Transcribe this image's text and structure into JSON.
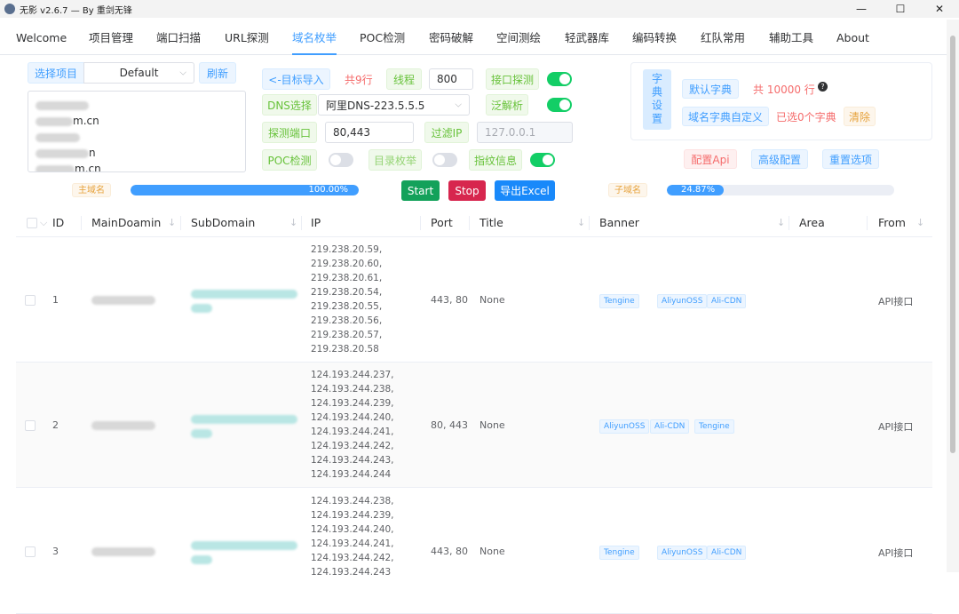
{
  "window": {
    "title": "无影 v2.6.7 — By 重剑无锋",
    "minimize": "—",
    "maximize": "☐",
    "close": "✕"
  },
  "tabs": [
    "Welcome",
    "项目管理",
    "端口扫描",
    "URL探测",
    "域名枚举",
    "POC检测",
    "密码破解",
    "空间测绘",
    "轻武器库",
    "编码转换",
    "红队常用",
    "辅助工具",
    "About"
  ],
  "active_tab": "域名枚举",
  "project": {
    "select_label": "选择项目",
    "selected": "Default",
    "refresh": "刷新",
    "items": [
      {
        "suffix": ""
      },
      {
        "suffix": "m.cn"
      },
      {
        "suffix": ""
      },
      {
        "suffix": "n"
      },
      {
        "suffix": "m.cn"
      }
    ]
  },
  "controls": {
    "import_btn": "<-目标导入",
    "count": "共9行",
    "thread_label": "线程",
    "thread_value": "800",
    "port_probe": "接口探测",
    "dns_label": "DNS选择",
    "dns_value": "阿里DNS-223.5.5.5",
    "wildcard": "泛解析",
    "probe_port_label": "探测端口",
    "probe_port_value": "80,443",
    "filter_ip_label": "过滤IP",
    "filter_ip_placeholder": "127.0.0.1",
    "poc_label": "POC检测",
    "dir_enum_label": "目录枚举",
    "fingerprint_label": "指纹信息"
  },
  "switches": {
    "port_probe": true,
    "wildcard": true,
    "poc": false,
    "dir_enum": false,
    "fingerprint": true
  },
  "dict": {
    "title": "字典设置",
    "default_dict": "默认字典",
    "total": "共 10000 行",
    "help": "?",
    "custom": "域名字典自定义",
    "selected": "已选0个字典",
    "clear": "清除"
  },
  "actions": {
    "config_api": "配置Api",
    "advanced": "高级配置",
    "reset": "重置选项",
    "start": "Start",
    "stop": "Stop",
    "export": "导出Excel"
  },
  "progress": {
    "main_label": "主域名",
    "main_percent": "100.00%",
    "main_value": 1.0,
    "sub_label": "子域名",
    "sub_percent": "24.87%",
    "sub_value": 0.2487
  },
  "table": {
    "columns": [
      "ID",
      "MainDoamin",
      "SubDomain",
      "IP",
      "Port",
      "Title",
      "Banner",
      "Area",
      "From"
    ],
    "rows": [
      {
        "id": "1",
        "ips": [
          "219.238.20.59,",
          "219.238.20.60,",
          "219.238.20.61,",
          "219.238.20.54,",
          "219.238.20.55,",
          "219.238.20.56,",
          "219.238.20.57,",
          "219.238.20.58"
        ],
        "port": "443, 80",
        "title": "None",
        "banner": [
          "Tengine",
          "AliyunOSS",
          "Ali-CDN"
        ],
        "from": "API接口"
      },
      {
        "id": "2",
        "ips": [
          "124.193.244.237,",
          "124.193.244.238,",
          "124.193.244.239,",
          "124.193.244.240,",
          "124.193.244.241,",
          "124.193.244.242,",
          "124.193.244.243,",
          "124.193.244.244"
        ],
        "port": "80, 443",
        "title": "None",
        "banner": [
          "AliyunOSS",
          "Ali-CDN",
          "Tengine"
        ],
        "from": "API接口"
      },
      {
        "id": "3",
        "ips": [
          "124.193.244.238,",
          "124.193.244.239,",
          "124.193.244.240,",
          "124.193.244.241,",
          "124.193.244.242,",
          "124.193.244.243"
        ],
        "port": "443, 80",
        "title": "None",
        "banner": [
          "Tengine",
          "AliyunOSS",
          "Ali-CDN"
        ],
        "from": "API接口"
      }
    ]
  }
}
